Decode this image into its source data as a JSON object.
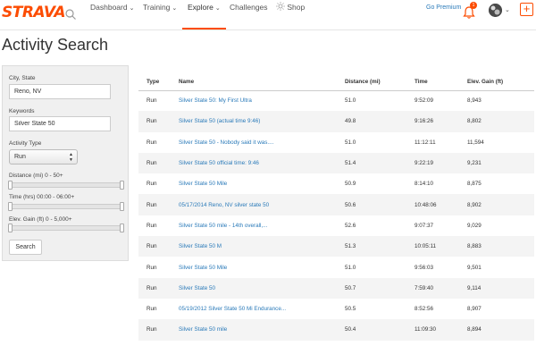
{
  "nav": {
    "logo": "STRAVA",
    "items": [
      {
        "label": "Dashboard",
        "chevron": "⌄"
      },
      {
        "label": "Training",
        "chevron": "⌄"
      },
      {
        "label": "Explore",
        "chevron": "⌄"
      },
      {
        "label": "Challenges",
        "chevron": ""
      },
      {
        "label": "Shop",
        "chevron": ""
      }
    ],
    "go_premium": "Go Premium",
    "notification_count": "1",
    "plus": "+"
  },
  "page_title": "Activity Search",
  "form": {
    "city_label": "City, State",
    "city_value": "Reno, NV",
    "keywords_label": "Keywords",
    "keywords_value": "Silver State 50",
    "activity_type_label": "Activity Type",
    "activity_type_value": "Run",
    "distance_label": "Distance (mi) 0 - 50+",
    "time_label": "Time (hrs) 00:00 - 06:00+",
    "elev_label": "Elev. Gain (ft) 0 - 5,000+",
    "search_button": "Search"
  },
  "table": {
    "headers": [
      "Type",
      "Name",
      "Distance (mi)",
      "Time",
      "Elev. Gain (ft)"
    ],
    "rows": [
      [
        "Run",
        "Silver State 50: My First Ultra",
        "51.0",
        "9:52:09",
        "8,943"
      ],
      [
        "Run",
        "Silver State 50 (actual time 9:46)",
        "49.8",
        "9:16:26",
        "8,802"
      ],
      [
        "Run",
        "Silver State 50 - Nobody said it was....",
        "51.0",
        "11:12:11",
        "11,594"
      ],
      [
        "Run",
        "Silver State 50 official time: 9:46",
        "51.4",
        "9:22:19",
        "9,231"
      ],
      [
        "Run",
        "Silver State 50 Mile",
        "50.9",
        "8:14:10",
        "8,875"
      ],
      [
        "Run",
        "05/17/2014 Reno, NV silver state 50",
        "50.6",
        "10:48:06",
        "8,902"
      ],
      [
        "Run",
        "Silver State 50 mile - 14th overall,...",
        "52.6",
        "9:07:37",
        "9,029"
      ],
      [
        "Run",
        "Silver State 50 M",
        "51.3",
        "10:05:11",
        "8,883"
      ],
      [
        "Run",
        "Silver State 50 Mile",
        "51.0",
        "9:56:03",
        "9,501"
      ],
      [
        "Run",
        "Silver State 50",
        "50.7",
        "7:59:40",
        "9,114"
      ],
      [
        "Run",
        "05/19/2012 Silver State 50 Mi Endurance...",
        "50.5",
        "8:52:56",
        "8,907"
      ],
      [
        "Run",
        "Silver State 50 mile",
        "50.4",
        "11:09:30",
        "8,894"
      ]
    ]
  },
  "colors": {
    "brand": "#fc4c02",
    "link": "#2a7ab9"
  }
}
